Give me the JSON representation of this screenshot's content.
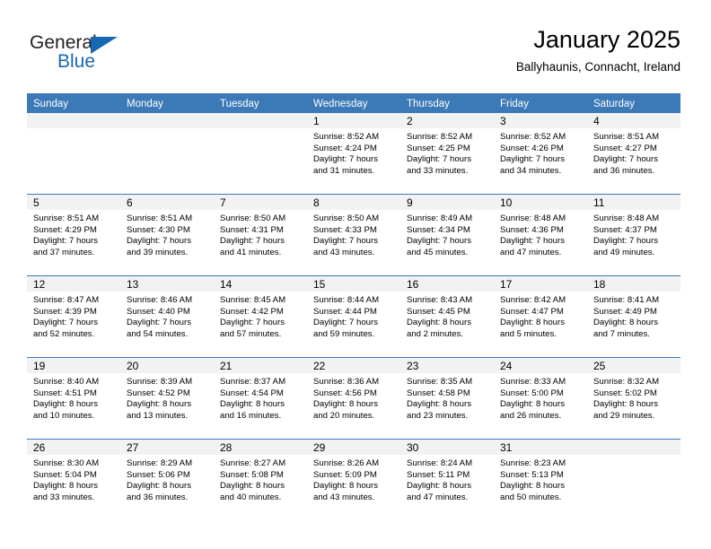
{
  "brand": {
    "name_top": "General",
    "name_bottom": "Blue",
    "accent_color": "#1668b3",
    "text_color": "#231f20"
  },
  "header": {
    "title": "January 2025",
    "subtitle": "Ballyhaunis, Connacht, Ireland"
  },
  "theme": {
    "header_bg": "#3b79b7",
    "header_text": "#ffffff",
    "daynum_band_bg": "#f2f2f2",
    "grid_line": "#3b79b7",
    "page_bg": "#ffffff"
  },
  "calendar": {
    "weekday_headers": [
      "Sunday",
      "Monday",
      "Tuesday",
      "Wednesday",
      "Thursday",
      "Friday",
      "Saturday"
    ],
    "labels": {
      "sunrise_prefix": "Sunrise:",
      "sunset_prefix": "Sunset:",
      "daylight_prefix": "Daylight:"
    },
    "weeks": [
      [
        {
          "empty": true
        },
        {
          "empty": true
        },
        {
          "empty": true
        },
        {
          "day": "1",
          "sunrise": "Sunrise: 8:52 AM",
          "sunset": "Sunset: 4:24 PM",
          "daylight_line1": "Daylight: 7 hours",
          "daylight_line2": "and 31 minutes."
        },
        {
          "day": "2",
          "sunrise": "Sunrise: 8:52 AM",
          "sunset": "Sunset: 4:25 PM",
          "daylight_line1": "Daylight: 7 hours",
          "daylight_line2": "and 33 minutes."
        },
        {
          "day": "3",
          "sunrise": "Sunrise: 8:52 AM",
          "sunset": "Sunset: 4:26 PM",
          "daylight_line1": "Daylight: 7 hours",
          "daylight_line2": "and 34 minutes."
        },
        {
          "day": "4",
          "sunrise": "Sunrise: 8:51 AM",
          "sunset": "Sunset: 4:27 PM",
          "daylight_line1": "Daylight: 7 hours",
          "daylight_line2": "and 36 minutes."
        }
      ],
      [
        {
          "day": "5",
          "sunrise": "Sunrise: 8:51 AM",
          "sunset": "Sunset: 4:29 PM",
          "daylight_line1": "Daylight: 7 hours",
          "daylight_line2": "and 37 minutes."
        },
        {
          "day": "6",
          "sunrise": "Sunrise: 8:51 AM",
          "sunset": "Sunset: 4:30 PM",
          "daylight_line1": "Daylight: 7 hours",
          "daylight_line2": "and 39 minutes."
        },
        {
          "day": "7",
          "sunrise": "Sunrise: 8:50 AM",
          "sunset": "Sunset: 4:31 PM",
          "daylight_line1": "Daylight: 7 hours",
          "daylight_line2": "and 41 minutes."
        },
        {
          "day": "8",
          "sunrise": "Sunrise: 8:50 AM",
          "sunset": "Sunset: 4:33 PM",
          "daylight_line1": "Daylight: 7 hours",
          "daylight_line2": "and 43 minutes."
        },
        {
          "day": "9",
          "sunrise": "Sunrise: 8:49 AM",
          "sunset": "Sunset: 4:34 PM",
          "daylight_line1": "Daylight: 7 hours",
          "daylight_line2": "and 45 minutes."
        },
        {
          "day": "10",
          "sunrise": "Sunrise: 8:48 AM",
          "sunset": "Sunset: 4:36 PM",
          "daylight_line1": "Daylight: 7 hours",
          "daylight_line2": "and 47 minutes."
        },
        {
          "day": "11",
          "sunrise": "Sunrise: 8:48 AM",
          "sunset": "Sunset: 4:37 PM",
          "daylight_line1": "Daylight: 7 hours",
          "daylight_line2": "and 49 minutes."
        }
      ],
      [
        {
          "day": "12",
          "sunrise": "Sunrise: 8:47 AM",
          "sunset": "Sunset: 4:39 PM",
          "daylight_line1": "Daylight: 7 hours",
          "daylight_line2": "and 52 minutes."
        },
        {
          "day": "13",
          "sunrise": "Sunrise: 8:46 AM",
          "sunset": "Sunset: 4:40 PM",
          "daylight_line1": "Daylight: 7 hours",
          "daylight_line2": "and 54 minutes."
        },
        {
          "day": "14",
          "sunrise": "Sunrise: 8:45 AM",
          "sunset": "Sunset: 4:42 PM",
          "daylight_line1": "Daylight: 7 hours",
          "daylight_line2": "and 57 minutes."
        },
        {
          "day": "15",
          "sunrise": "Sunrise: 8:44 AM",
          "sunset": "Sunset: 4:44 PM",
          "daylight_line1": "Daylight: 7 hours",
          "daylight_line2": "and 59 minutes."
        },
        {
          "day": "16",
          "sunrise": "Sunrise: 8:43 AM",
          "sunset": "Sunset: 4:45 PM",
          "daylight_line1": "Daylight: 8 hours",
          "daylight_line2": "and 2 minutes."
        },
        {
          "day": "17",
          "sunrise": "Sunrise: 8:42 AM",
          "sunset": "Sunset: 4:47 PM",
          "daylight_line1": "Daylight: 8 hours",
          "daylight_line2": "and 5 minutes."
        },
        {
          "day": "18",
          "sunrise": "Sunrise: 8:41 AM",
          "sunset": "Sunset: 4:49 PM",
          "daylight_line1": "Daylight: 8 hours",
          "daylight_line2": "and 7 minutes."
        }
      ],
      [
        {
          "day": "19",
          "sunrise": "Sunrise: 8:40 AM",
          "sunset": "Sunset: 4:51 PM",
          "daylight_line1": "Daylight: 8 hours",
          "daylight_line2": "and 10 minutes."
        },
        {
          "day": "20",
          "sunrise": "Sunrise: 8:39 AM",
          "sunset": "Sunset: 4:52 PM",
          "daylight_line1": "Daylight: 8 hours",
          "daylight_line2": "and 13 minutes."
        },
        {
          "day": "21",
          "sunrise": "Sunrise: 8:37 AM",
          "sunset": "Sunset: 4:54 PM",
          "daylight_line1": "Daylight: 8 hours",
          "daylight_line2": "and 16 minutes."
        },
        {
          "day": "22",
          "sunrise": "Sunrise: 8:36 AM",
          "sunset": "Sunset: 4:56 PM",
          "daylight_line1": "Daylight: 8 hours",
          "daylight_line2": "and 20 minutes."
        },
        {
          "day": "23",
          "sunrise": "Sunrise: 8:35 AM",
          "sunset": "Sunset: 4:58 PM",
          "daylight_line1": "Daylight: 8 hours",
          "daylight_line2": "and 23 minutes."
        },
        {
          "day": "24",
          "sunrise": "Sunrise: 8:33 AM",
          "sunset": "Sunset: 5:00 PM",
          "daylight_line1": "Daylight: 8 hours",
          "daylight_line2": "and 26 minutes."
        },
        {
          "day": "25",
          "sunrise": "Sunrise: 8:32 AM",
          "sunset": "Sunset: 5:02 PM",
          "daylight_line1": "Daylight: 8 hours",
          "daylight_line2": "and 29 minutes."
        }
      ],
      [
        {
          "day": "26",
          "sunrise": "Sunrise: 8:30 AM",
          "sunset": "Sunset: 5:04 PM",
          "daylight_line1": "Daylight: 8 hours",
          "daylight_line2": "and 33 minutes."
        },
        {
          "day": "27",
          "sunrise": "Sunrise: 8:29 AM",
          "sunset": "Sunset: 5:06 PM",
          "daylight_line1": "Daylight: 8 hours",
          "daylight_line2": "and 36 minutes."
        },
        {
          "day": "28",
          "sunrise": "Sunrise: 8:27 AM",
          "sunset": "Sunset: 5:08 PM",
          "daylight_line1": "Daylight: 8 hours",
          "daylight_line2": "and 40 minutes."
        },
        {
          "day": "29",
          "sunrise": "Sunrise: 8:26 AM",
          "sunset": "Sunset: 5:09 PM",
          "daylight_line1": "Daylight: 8 hours",
          "daylight_line2": "and 43 minutes."
        },
        {
          "day": "30",
          "sunrise": "Sunrise: 8:24 AM",
          "sunset": "Sunset: 5:11 PM",
          "daylight_line1": "Daylight: 8 hours",
          "daylight_line2": "and 47 minutes."
        },
        {
          "day": "31",
          "sunrise": "Sunrise: 8:23 AM",
          "sunset": "Sunset: 5:13 PM",
          "daylight_line1": "Daylight: 8 hours",
          "daylight_line2": "and 50 minutes."
        },
        {
          "empty": true
        }
      ]
    ]
  }
}
